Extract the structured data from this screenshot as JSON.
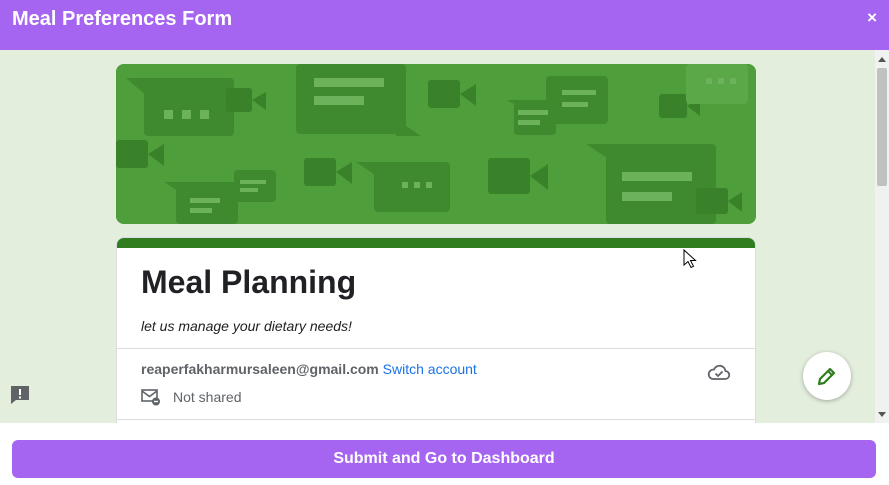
{
  "modal": {
    "title": "Meal Preferences Form",
    "close_label": "×"
  },
  "form": {
    "title": "Meal Planning",
    "description": "let us manage your dietary needs!",
    "account_email": "reaperfakharmursaleen@gmail.com",
    "switch_account_label": "Switch account",
    "shared_status": "Not shared"
  },
  "footer": {
    "submit_label": "Submit and Go to Dashboard"
  },
  "icons": {
    "close": "close-icon",
    "cloud": "cloud-check-icon",
    "mail": "mail-not-shared-icon",
    "edit": "pencil-icon",
    "feedback": "feedback-icon",
    "cursor": "mouse-pointer-icon"
  },
  "colors": {
    "accent": "#a665f1",
    "banner_green": "#4f9e3c",
    "card_top_green": "#2f7d1e",
    "link_blue": "#1a73e8",
    "frame_bg": "#e3eedd"
  }
}
